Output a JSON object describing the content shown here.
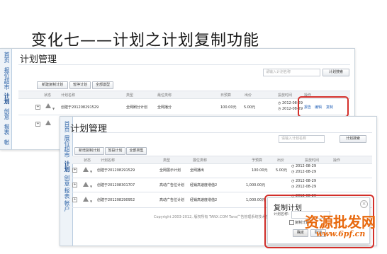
{
  "slide": {
    "title": "变化七——计划之计划复制功能"
  },
  "w1": {
    "sidebar": [
      "首页",
      "报位超市",
      "计划",
      "创意",
      "报表",
      "帐"
    ],
    "page_title": "计划管理",
    "search_placeholder": "请输入计划名称",
    "search_button": "计划搜索",
    "buttons": [
      "新建复制计划",
      "暂停计划",
      "全部激型"
    ],
    "columns": [
      "状态",
      "计划名称",
      "类型",
      "最位类称",
      "日预算",
      "出价",
      "投放时间",
      "操作"
    ],
    "row": {
      "name": "创建于201208291529",
      "type": "全网刷分计划",
      "slot": "全网播分",
      "budget": "100.00元",
      "bid": "5.00元",
      "date1": "2012-08-29",
      "date2": "2012-08-29",
      "actions": [
        "报告",
        "编辑",
        "复制"
      ]
    }
  },
  "w2": {
    "sidebar": [
      "首页",
      "展位超市",
      "计划",
      "创意",
      "报表",
      "帐户"
    ],
    "page_title": "计划管理",
    "search_placeholder": "请输入计划名称",
    "search_button": "计划搜索",
    "buttons": [
      "新增复制计划",
      "暂投计划",
      "全部类型"
    ],
    "columns": [
      "状态",
      "计划名称",
      "类型",
      "展位类称",
      "予预算",
      "出价",
      "投放时间",
      "操作"
    ],
    "rows": [
      {
        "name": "创建于201208291529",
        "type": "全网展示计划",
        "slot": "全网播出",
        "budget": "100.00元",
        "bid": "5.00元",
        "date1": "2012-08-29",
        "date2": "2012-08-29"
      },
      {
        "name": "创建于201208301707",
        "type": "高动广告位计划",
        "slot": "经销高速度增值2",
        "budget": "1,000.00元",
        "bid": "",
        "date1": "2012-08-29",
        "date2": "2012-08-29"
      },
      {
        "name": "创建于201208290952",
        "type": "高动广告位计划",
        "slot": "经销高速度增值2",
        "budget": "1,000.00元",
        "bid": "",
        "date1": "2012-08-29",
        "date2": "2012-08-29"
      }
    ],
    "footer": "Copyright 2003-2012, 版权所有 TANX.COM",
    "footer2": "Tanx广告管理系统技术在线"
  },
  "dialog": {
    "title": "复制计划",
    "field_label": "计划名称：",
    "checkbox_label": "复制计划",
    "confirm": "确定",
    "cancel": "取消"
  },
  "watermark": {
    "text": "资源批发网",
    "url": "www.6pf.cn"
  }
}
